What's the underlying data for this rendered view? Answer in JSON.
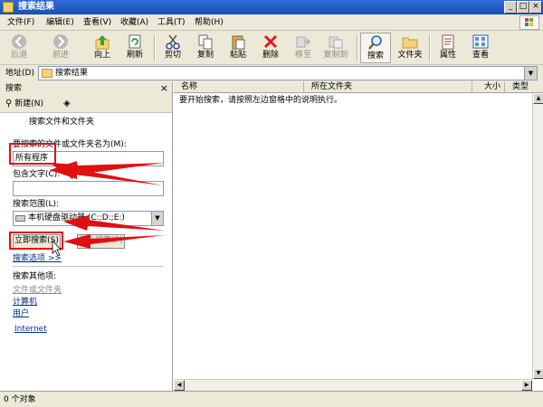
{
  "window": {
    "title": "搜索结果"
  },
  "menu": [
    "文件(F)",
    "编辑(E)",
    "查看(V)",
    "收藏(A)",
    "工具(T)",
    "帮助(H)"
  ],
  "toolbar": {
    "back": "后退",
    "forward": "前进",
    "up": "向上",
    "refresh": "刷新",
    "cut": "剪切",
    "copy": "复制",
    "paste": "粘贴",
    "delete": "删除",
    "move_to": "移至",
    "copy_to": "复制到",
    "search": "搜索",
    "folders": "文件夹",
    "properties": "属性",
    "views": "查看"
  },
  "address": {
    "label": "地址(D)",
    "value": "搜索结果"
  },
  "search_pane": {
    "title": "搜索",
    "close": "×",
    "new_label": "新建(N)",
    "section_title": "搜索文件和文件夹",
    "name_label": "要搜索的文件或文件夹名为(M):",
    "name_value": "所有程序",
    "contains_label": "包含文字(C):",
    "contains_value": "",
    "scope_label": "搜索范围(L):",
    "scope_value": "本机硬盘驱动器 (C:;D:;E:)",
    "search_now": "立即搜索(S)",
    "stop_search": "停止搜索(P)",
    "options_link": "搜索选项 >>",
    "other_heading": "搜索其他项:",
    "other_items": [
      "文件或文件夹",
      "计算机",
      "用户"
    ],
    "internet_link": "Internet"
  },
  "list": {
    "columns": [
      "名称",
      "所在文件夹",
      "大小",
      "类型"
    ],
    "empty_message": "要开始搜索，请按照左边窗格中的说明执行。"
  },
  "status": {
    "text": "0 个对象"
  },
  "colors": {
    "annotation": "#e01010",
    "titlebar": "#1b4fb5"
  }
}
